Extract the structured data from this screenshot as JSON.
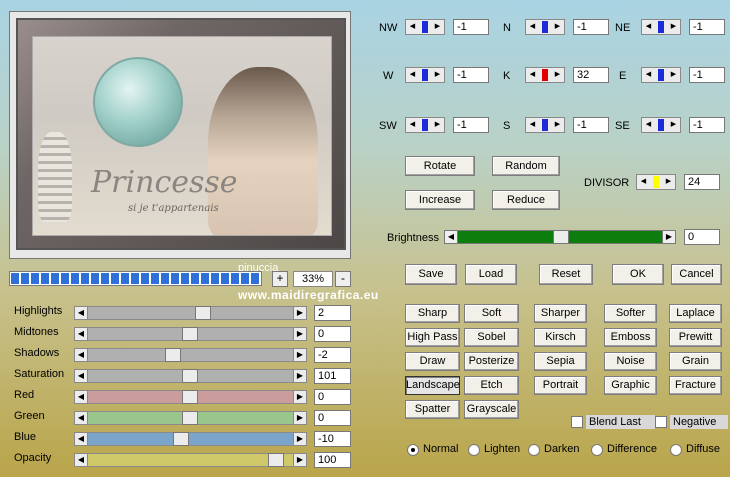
{
  "preview": {
    "art_title_text": "Princesse",
    "art_subtitle_text": "si je t'appartenais",
    "watermark_left": "pinuccia",
    "watermark_url": "www.maidiregrafica.eu"
  },
  "zoom": {
    "minus": "-",
    "plus": "+",
    "value": "33%",
    "progress_fraction": 1.0
  },
  "sliders": [
    {
      "label": "Highlights",
      "value": "2",
      "thumb_fraction": 0.57,
      "track_color": "#b0b0b0"
    },
    {
      "label": "Midtones",
      "value": "0",
      "thumb_fraction": 0.5,
      "track_color": "#b0b0b0"
    },
    {
      "label": "Shadows",
      "value": "-2",
      "thumb_fraction": 0.41,
      "track_color": "#b0b0b0"
    },
    {
      "label": "Saturation",
      "value": "101",
      "thumb_fraction": 0.5,
      "track_color": "#b0b0b0"
    },
    {
      "label": "Red",
      "value": "0",
      "thumb_fraction": 0.5,
      "track_color": "#cb9c9c"
    },
    {
      "label": "Green",
      "value": "0",
      "thumb_fraction": 0.5,
      "track_color": "#98c68c"
    },
    {
      "label": "Blue",
      "value": "-10",
      "thumb_fraction": 0.45,
      "track_color": "#7aa4c9"
    },
    {
      "label": "Opacity",
      "value": "100",
      "thumb_fraction": 0.96,
      "track_color": "#cfc96a"
    }
  ],
  "kernel": [
    {
      "label": "NW",
      "value": "-1",
      "color": "#1e2bd8"
    },
    {
      "label": "N",
      "value": "-1",
      "color": "#1e2bd8"
    },
    {
      "label": "NE",
      "value": "-1",
      "color": "#1e2bd8"
    },
    {
      "label": "W",
      "value": "-1",
      "color": "#1e2bd8"
    },
    {
      "label": "K",
      "value": "32",
      "color": "#e00000"
    },
    {
      "label": "E",
      "value": "-1",
      "color": "#1e2bd8"
    },
    {
      "label": "SW",
      "value": "-1",
      "color": "#1e2bd8"
    },
    {
      "label": "S",
      "value": "-1",
      "color": "#1e2bd8"
    },
    {
      "label": "SE",
      "value": "-1",
      "color": "#1e2bd8"
    }
  ],
  "actions": {
    "rotate": "Rotate",
    "random": "Random",
    "increase": "Increase",
    "reduce": "Reduce"
  },
  "divisor": {
    "label": "DIVISOR",
    "value": "24",
    "color": "#ffff00"
  },
  "brightness": {
    "label": "Brightness",
    "value": "0",
    "thumb_fraction": 0.5
  },
  "file_buttons": {
    "save": "Save",
    "load": "Load",
    "reset": "Reset",
    "ok": "OK",
    "cancel": "Cancel"
  },
  "presets": [
    [
      "Sharp",
      "Soft",
      "Sharper",
      "Softer",
      "Laplace"
    ],
    [
      "High Pass",
      "Sobel",
      "Kirsch",
      "Emboss",
      "Prewitt"
    ],
    [
      "Draw",
      "Posterize",
      "Sepia",
      "Noise",
      "Grain"
    ],
    [
      "Landscape",
      "Etch",
      "Portrait",
      "Graphic",
      "Fracture"
    ],
    [
      "Spatter",
      "Grayscale"
    ]
  ],
  "active_preset": "Landscape",
  "options": {
    "blend_last": "Blend Last",
    "negative": "Negative"
  },
  "modes": [
    {
      "label": "Normal",
      "selected": true
    },
    {
      "label": "Lighten",
      "selected": false
    },
    {
      "label": "Darken",
      "selected": false
    },
    {
      "label": "Difference",
      "selected": false
    },
    {
      "label": "Diffuse",
      "selected": false
    }
  ]
}
